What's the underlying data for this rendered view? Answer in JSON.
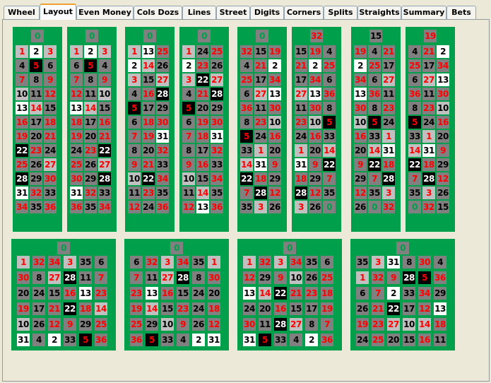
{
  "tabs": [
    {
      "label": "Wheel"
    },
    {
      "label": "Layout"
    },
    {
      "label": "Even Money"
    },
    {
      "label": "Cols Dozs"
    },
    {
      "label": "Lines"
    },
    {
      "label": "Street"
    },
    {
      "label": "Digits"
    },
    {
      "label": "Corners"
    },
    {
      "label": "Splits"
    },
    {
      "label": "Straights"
    },
    {
      "label": "Summary"
    },
    {
      "label": "Bets"
    }
  ],
  "active_tab": "Layout",
  "number_colors": {
    "red": "#ff0000",
    "black": "#000000",
    "green": "#009f4b",
    "table_felt": "#009f4b"
  },
  "legend_cell_styles": {
    "default": "gray",
    "recent": "light-gray",
    "current": "white",
    "hit": "black"
  },
  "top_boards": [
    {
      "zero": "0",
      "rows": [
        [
          "1",
          "2",
          "3"
        ],
        [
          "4",
          "5",
          "6"
        ],
        [
          "7",
          "8",
          "9"
        ],
        [
          "10",
          "11",
          "12"
        ],
        [
          "13",
          "14",
          "15"
        ],
        [
          "16",
          "17",
          "18"
        ],
        [
          "19",
          "20",
          "21"
        ],
        [
          "22",
          "23",
          "24"
        ],
        [
          "25",
          "26",
          "27"
        ],
        [
          "28",
          "29",
          "30"
        ],
        [
          "31",
          "32",
          "33"
        ],
        [
          "34",
          "35",
          "36"
        ]
      ]
    },
    {
      "zero": "0",
      "rows": [
        [
          "1",
          "2",
          "3"
        ],
        [
          "6",
          "5",
          "4"
        ],
        [
          "7",
          "8",
          "9"
        ],
        [
          "12",
          "11",
          "10"
        ],
        [
          "13",
          "14",
          "15"
        ],
        [
          "18",
          "17",
          "16"
        ],
        [
          "19",
          "20",
          "21"
        ],
        [
          "24",
          "23",
          "22"
        ],
        [
          "25",
          "26",
          "27"
        ],
        [
          "30",
          "29",
          "28"
        ],
        [
          "31",
          "32",
          "33"
        ],
        [
          "36",
          "35",
          "34"
        ]
      ]
    },
    {
      "zero": "0",
      "rows": [
        [
          "1",
          "13",
          "25"
        ],
        [
          "2",
          "14",
          "26"
        ],
        [
          "3",
          "15",
          "27"
        ],
        [
          "4",
          "16",
          "28"
        ],
        [
          "5",
          "17",
          "29"
        ],
        [
          "6",
          "18",
          "30"
        ],
        [
          "7",
          "19",
          "31"
        ],
        [
          "8",
          "20",
          "32"
        ],
        [
          "9",
          "21",
          "33"
        ],
        [
          "10",
          "22",
          "34"
        ],
        [
          "11",
          "23",
          "35"
        ],
        [
          "12",
          "24",
          "36"
        ]
      ]
    },
    {
      "zero": "0",
      "rows": [
        [
          "1",
          "24",
          "25"
        ],
        [
          "2",
          "23",
          "26"
        ],
        [
          "3",
          "22",
          "27"
        ],
        [
          "4",
          "21",
          "28"
        ],
        [
          "5",
          "20",
          "29"
        ],
        [
          "6",
          "19",
          "30"
        ],
        [
          "7",
          "18",
          "31"
        ],
        [
          "8",
          "17",
          "32"
        ],
        [
          "9",
          "16",
          "33"
        ],
        [
          "10",
          "15",
          "34"
        ],
        [
          "11",
          "14",
          "35"
        ],
        [
          "12",
          "13",
          "36"
        ]
      ]
    },
    {
      "zero": "0",
      "rows": [
        [
          "32",
          "15",
          "19"
        ],
        [
          "4",
          "21",
          "2"
        ],
        [
          "25",
          "17",
          "34"
        ],
        [
          "6",
          "27",
          "13"
        ],
        [
          "36",
          "11",
          "30"
        ],
        [
          "8",
          "23",
          "10"
        ],
        [
          "5",
          "24",
          "16"
        ],
        [
          "33",
          "1",
          "20"
        ],
        [
          "14",
          "31",
          "9"
        ],
        [
          "22",
          "18",
          "29"
        ],
        [
          "7",
          "28",
          "12"
        ],
        [
          "35",
          "3",
          "26"
        ]
      ]
    },
    {
      "zero": "32",
      "rows": [
        [
          "15",
          "19",
          "4"
        ],
        [
          "21",
          "2",
          "25"
        ],
        [
          "17",
          "34",
          "6"
        ],
        [
          "27",
          "13",
          "36"
        ],
        [
          "11",
          "30",
          "8"
        ],
        [
          "23",
          "10",
          "5"
        ],
        [
          "24",
          "16",
          "33"
        ],
        [
          "1",
          "20",
          "14"
        ],
        [
          "31",
          "9",
          "22"
        ],
        [
          "18",
          "29",
          "7"
        ],
        [
          "28",
          "12",
          "35"
        ],
        [
          "3",
          "26",
          "0"
        ]
      ]
    },
    {
      "zero": "15",
      "rows": [
        [
          "19",
          "4",
          "21"
        ],
        [
          "2",
          "25",
          "17"
        ],
        [
          "34",
          "6",
          "27"
        ],
        [
          "13",
          "36",
          "11"
        ],
        [
          "30",
          "8",
          "23"
        ],
        [
          "10",
          "5",
          "24"
        ],
        [
          "16",
          "33",
          "1"
        ],
        [
          "20",
          "14",
          "31"
        ],
        [
          "9",
          "22",
          "18"
        ],
        [
          "29",
          "7",
          "28"
        ],
        [
          "12",
          "35",
          "3"
        ],
        [
          "26",
          "0",
          "32"
        ]
      ]
    },
    {
      "zero": "19",
      "rows": [
        [
          "4",
          "21",
          "2"
        ],
        [
          "25",
          "17",
          "34"
        ],
        [
          "6",
          "27",
          "13"
        ],
        [
          "36",
          "11",
          "30"
        ],
        [
          "8",
          "23",
          "10"
        ],
        [
          "5",
          "24",
          "16"
        ],
        [
          "33",
          "1",
          "20"
        ],
        [
          "14",
          "31",
          "9"
        ],
        [
          "22",
          "18",
          "29"
        ],
        [
          "7",
          "28",
          "12"
        ],
        [
          "35",
          "3",
          "26"
        ],
        [
          "0",
          "32",
          "15"
        ]
      ]
    }
  ],
  "bottom_boards": [
    {
      "zero": "0",
      "rows": [
        [
          "1",
          "32",
          "34",
          "3",
          "35",
          "6"
        ],
        [
          "30",
          "8",
          "27",
          "28",
          "11",
          "7"
        ],
        [
          "20",
          "24",
          "15",
          "16",
          "13",
          "23"
        ],
        [
          "19",
          "17",
          "21",
          "22",
          "18",
          "14"
        ],
        [
          "10",
          "26",
          "12",
          "9",
          "29",
          "25"
        ],
        [
          "31",
          "4",
          "2",
          "33",
          "5",
          "36"
        ]
      ]
    },
    {
      "zero": "0",
      "rows": [
        [
          "6",
          "32",
          "3",
          "34",
          "35",
          "1"
        ],
        [
          "7",
          "11",
          "27",
          "28",
          "8",
          "30"
        ],
        [
          "23",
          "13",
          "16",
          "15",
          "24",
          "20"
        ],
        [
          "19",
          "14",
          "15",
          "23",
          "24",
          "18"
        ],
        [
          "25",
          "29",
          "10",
          "9",
          "26",
          "12"
        ],
        [
          "36",
          "5",
          "33",
          "4",
          "2",
          "31"
        ]
      ]
    },
    {
      "zero": "0",
      "rows": [
        [
          "1",
          "32",
          "3",
          "34",
          "35",
          "6"
        ],
        [
          "12",
          "29",
          "9",
          "10",
          "26",
          "25"
        ],
        [
          "13",
          "14",
          "22",
          "21",
          "23",
          "18"
        ],
        [
          "24",
          "20",
          "16",
          "15",
          "17",
          "19"
        ],
        [
          "30",
          "11",
          "28",
          "27",
          "8",
          "7"
        ],
        [
          "31",
          "5",
          "33",
          "4",
          "2",
          "36"
        ]
      ]
    },
    {
      "zero": "0",
      "rows": [
        [
          "35",
          "3",
          "31",
          "8",
          "30",
          "4"
        ],
        [
          "1",
          "32",
          "9",
          "28",
          "5",
          "36"
        ],
        [
          "6",
          "7",
          "2",
          "33",
          "34",
          "29"
        ],
        [
          "26",
          "21",
          "22",
          "17",
          "12",
          "13"
        ],
        [
          "19",
          "23",
          "27",
          "10",
          "14",
          "18"
        ],
        [
          "24",
          "25",
          "20",
          "15",
          "16",
          "11"
        ]
      ]
    }
  ],
  "highlights": {
    "top_boards": [
      {
        "hl": [
          "1",
          "3",
          "14",
          "27",
          "10"
        ],
        "w": [
          "2",
          "13",
          "31"
        ],
        "k": [
          "5",
          "22",
          "28"
        ]
      },
      {
        "hl": [
          "1",
          "3",
          "14",
          "27",
          "10"
        ],
        "w": [
          "2",
          "13",
          "31"
        ],
        "k": [
          "5",
          "22",
          "28"
        ]
      },
      {
        "hl": [
          "1",
          "3",
          "14",
          "27",
          "10"
        ],
        "w": [
          "2",
          "13",
          "31"
        ],
        "k": [
          "5",
          "22",
          "28"
        ]
      },
      {
        "hl": [
          "1",
          "3",
          "14",
          "27",
          "10"
        ],
        "w": [
          "2",
          "13",
          "31"
        ],
        "k": [
          "5",
          "22",
          "28"
        ]
      },
      {
        "hl": [
          "1",
          "3",
          "14",
          "27",
          "10"
        ],
        "w": [
          "2",
          "13",
          "31"
        ],
        "k": [
          "5",
          "22",
          "28"
        ]
      },
      {
        "hl": [
          "1",
          "3",
          "14",
          "27",
          "10"
        ],
        "w": [
          "2",
          "13",
          "31"
        ],
        "k": [
          "5",
          "22",
          "28"
        ]
      },
      {
        "hl": [
          "1",
          "3",
          "14",
          "27",
          "10"
        ],
        "w": [
          "2",
          "13",
          "31"
        ],
        "k": [
          "5",
          "22",
          "28"
        ]
      },
      {
        "hl": [
          "1",
          "3",
          "14",
          "27",
          "10"
        ],
        "w": [
          "2",
          "13",
          "31"
        ],
        "k": [
          "5",
          "22",
          "28"
        ]
      }
    ],
    "bottom_boards": [
      {
        "hl": [
          "1",
          "3",
          "14",
          "27",
          "10"
        ],
        "w": [
          "2",
          "13",
          "31"
        ],
        "k": [
          "5",
          "22",
          "28"
        ]
      },
      {
        "hl": [
          "1",
          "3",
          "14",
          "27",
          "10"
        ],
        "w": [
          "2",
          "13",
          "31"
        ],
        "k": [
          "5",
          "22",
          "28"
        ]
      },
      {
        "hl": [
          "1",
          "3",
          "14",
          "27",
          "10"
        ],
        "w": [
          "2",
          "13",
          "31"
        ],
        "k": [
          "5",
          "22",
          "28"
        ]
      },
      {
        "hl": [
          "1",
          "3",
          "14",
          "27",
          "10"
        ],
        "w": [
          "2",
          "13",
          "31"
        ],
        "k": [
          "5",
          "22",
          "28"
        ]
      }
    ]
  }
}
